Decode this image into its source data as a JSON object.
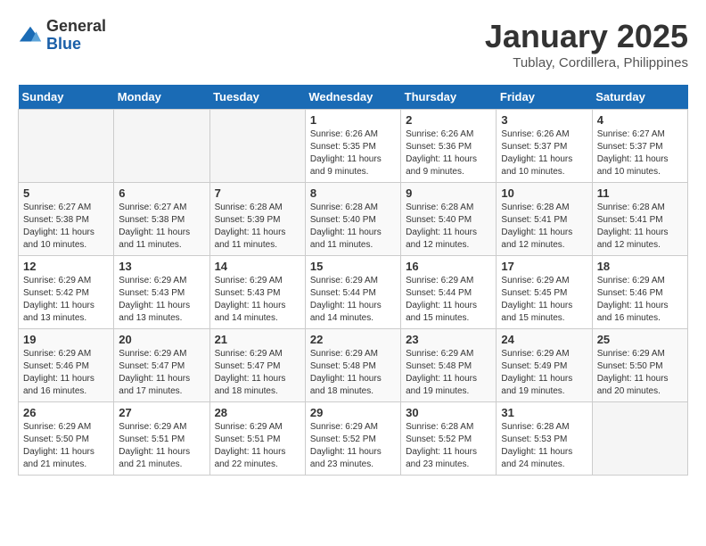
{
  "header": {
    "logo_general": "General",
    "logo_blue": "Blue",
    "month_title": "January 2025",
    "location": "Tublay, Cordillera, Philippines"
  },
  "days_of_week": [
    "Sunday",
    "Monday",
    "Tuesday",
    "Wednesday",
    "Thursday",
    "Friday",
    "Saturday"
  ],
  "weeks": [
    [
      {
        "day": "",
        "info": ""
      },
      {
        "day": "",
        "info": ""
      },
      {
        "day": "",
        "info": ""
      },
      {
        "day": "1",
        "info": "Sunrise: 6:26 AM\nSunset: 5:35 PM\nDaylight: 11 hours\nand 9 minutes."
      },
      {
        "day": "2",
        "info": "Sunrise: 6:26 AM\nSunset: 5:36 PM\nDaylight: 11 hours\nand 9 minutes."
      },
      {
        "day": "3",
        "info": "Sunrise: 6:26 AM\nSunset: 5:37 PM\nDaylight: 11 hours\nand 10 minutes."
      },
      {
        "day": "4",
        "info": "Sunrise: 6:27 AM\nSunset: 5:37 PM\nDaylight: 11 hours\nand 10 minutes."
      }
    ],
    [
      {
        "day": "5",
        "info": "Sunrise: 6:27 AM\nSunset: 5:38 PM\nDaylight: 11 hours\nand 10 minutes."
      },
      {
        "day": "6",
        "info": "Sunrise: 6:27 AM\nSunset: 5:38 PM\nDaylight: 11 hours\nand 11 minutes."
      },
      {
        "day": "7",
        "info": "Sunrise: 6:28 AM\nSunset: 5:39 PM\nDaylight: 11 hours\nand 11 minutes."
      },
      {
        "day": "8",
        "info": "Sunrise: 6:28 AM\nSunset: 5:40 PM\nDaylight: 11 hours\nand 11 minutes."
      },
      {
        "day": "9",
        "info": "Sunrise: 6:28 AM\nSunset: 5:40 PM\nDaylight: 11 hours\nand 12 minutes."
      },
      {
        "day": "10",
        "info": "Sunrise: 6:28 AM\nSunset: 5:41 PM\nDaylight: 11 hours\nand 12 minutes."
      },
      {
        "day": "11",
        "info": "Sunrise: 6:28 AM\nSunset: 5:41 PM\nDaylight: 11 hours\nand 12 minutes."
      }
    ],
    [
      {
        "day": "12",
        "info": "Sunrise: 6:29 AM\nSunset: 5:42 PM\nDaylight: 11 hours\nand 13 minutes."
      },
      {
        "day": "13",
        "info": "Sunrise: 6:29 AM\nSunset: 5:43 PM\nDaylight: 11 hours\nand 13 minutes."
      },
      {
        "day": "14",
        "info": "Sunrise: 6:29 AM\nSunset: 5:43 PM\nDaylight: 11 hours\nand 14 minutes."
      },
      {
        "day": "15",
        "info": "Sunrise: 6:29 AM\nSunset: 5:44 PM\nDaylight: 11 hours\nand 14 minutes."
      },
      {
        "day": "16",
        "info": "Sunrise: 6:29 AM\nSunset: 5:44 PM\nDaylight: 11 hours\nand 15 minutes."
      },
      {
        "day": "17",
        "info": "Sunrise: 6:29 AM\nSunset: 5:45 PM\nDaylight: 11 hours\nand 15 minutes."
      },
      {
        "day": "18",
        "info": "Sunrise: 6:29 AM\nSunset: 5:46 PM\nDaylight: 11 hours\nand 16 minutes."
      }
    ],
    [
      {
        "day": "19",
        "info": "Sunrise: 6:29 AM\nSunset: 5:46 PM\nDaylight: 11 hours\nand 16 minutes."
      },
      {
        "day": "20",
        "info": "Sunrise: 6:29 AM\nSunset: 5:47 PM\nDaylight: 11 hours\nand 17 minutes."
      },
      {
        "day": "21",
        "info": "Sunrise: 6:29 AM\nSunset: 5:47 PM\nDaylight: 11 hours\nand 18 minutes."
      },
      {
        "day": "22",
        "info": "Sunrise: 6:29 AM\nSunset: 5:48 PM\nDaylight: 11 hours\nand 18 minutes."
      },
      {
        "day": "23",
        "info": "Sunrise: 6:29 AM\nSunset: 5:48 PM\nDaylight: 11 hours\nand 19 minutes."
      },
      {
        "day": "24",
        "info": "Sunrise: 6:29 AM\nSunset: 5:49 PM\nDaylight: 11 hours\nand 19 minutes."
      },
      {
        "day": "25",
        "info": "Sunrise: 6:29 AM\nSunset: 5:50 PM\nDaylight: 11 hours\nand 20 minutes."
      }
    ],
    [
      {
        "day": "26",
        "info": "Sunrise: 6:29 AM\nSunset: 5:50 PM\nDaylight: 11 hours\nand 21 minutes."
      },
      {
        "day": "27",
        "info": "Sunrise: 6:29 AM\nSunset: 5:51 PM\nDaylight: 11 hours\nand 21 minutes."
      },
      {
        "day": "28",
        "info": "Sunrise: 6:29 AM\nSunset: 5:51 PM\nDaylight: 11 hours\nand 22 minutes."
      },
      {
        "day": "29",
        "info": "Sunrise: 6:29 AM\nSunset: 5:52 PM\nDaylight: 11 hours\nand 23 minutes."
      },
      {
        "day": "30",
        "info": "Sunrise: 6:28 AM\nSunset: 5:52 PM\nDaylight: 11 hours\nand 23 minutes."
      },
      {
        "day": "31",
        "info": "Sunrise: 6:28 AM\nSunset: 5:53 PM\nDaylight: 11 hours\nand 24 minutes."
      },
      {
        "day": "",
        "info": ""
      }
    ]
  ]
}
